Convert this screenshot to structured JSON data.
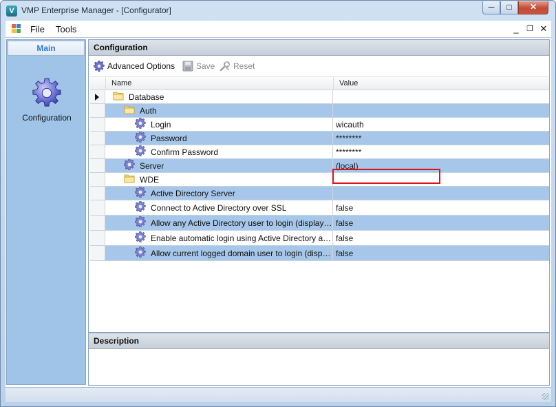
{
  "window": {
    "title": "VMP Enterprise Manager - [Configurator]",
    "app_icon_glyph": "V",
    "minimize_glyph": "─",
    "maximize_glyph": "□",
    "close_glyph": "✕"
  },
  "menubar": {
    "items": [
      "File",
      "Tools"
    ],
    "mdi_minimize_glyph": "_",
    "mdi_restore_glyph": "❐",
    "mdi_close_glyph": "✕"
  },
  "sidebar": {
    "header": "Main",
    "items": [
      {
        "label": "Configuration",
        "icon": "gear-icon"
      }
    ]
  },
  "configuration": {
    "title": "Configuration",
    "toolbar": {
      "advanced_options": "Advanced Options",
      "save": "Save",
      "reset": "Reset"
    },
    "columns": [
      "Name",
      "Value"
    ],
    "rows": [
      {
        "name": "Database",
        "value": "",
        "icon": "folder-icon",
        "level": 0,
        "current": true
      },
      {
        "name": "Auth",
        "value": "",
        "icon": "folder-icon",
        "level": 1
      },
      {
        "name": "Login",
        "value": "wicauth",
        "icon": "gear-icon",
        "level": 2
      },
      {
        "name": "Password",
        "value": "********",
        "icon": "gear-icon",
        "level": 2,
        "highlighted": true
      },
      {
        "name": "Confirm Password",
        "value": "********",
        "icon": "gear-icon",
        "level": 2
      },
      {
        "name": "Server",
        "value": "(local)",
        "icon": "gear-icon",
        "level": 1
      },
      {
        "name": "WDE",
        "value": "",
        "icon": "folder-icon",
        "level": 1
      },
      {
        "name": "Active Directory Server",
        "value": "",
        "icon": "gear-icon",
        "level": 2
      },
      {
        "name": "Connect to Active Directory over SSL",
        "value": "false",
        "icon": "gear-icon",
        "level": 2
      },
      {
        "name": "Allow any Active Directory user to login (display lo...",
        "value": "false",
        "icon": "gear-icon",
        "level": 2
      },
      {
        "name": "Enable automatic login using Active Directory auth...",
        "value": "false",
        "icon": "gear-icon",
        "level": 2
      },
      {
        "name": "Allow current logged domain user to login (displa...",
        "value": "false",
        "icon": "gear-icon",
        "level": 2
      }
    ]
  },
  "description": {
    "title": "Description",
    "text": ""
  },
  "colors": {
    "row_alt": "#a6c7e9",
    "highlight_border": "#e0101a",
    "nav_bg": "#9fc4e8",
    "nav_header_text": "#2f7ad1"
  }
}
